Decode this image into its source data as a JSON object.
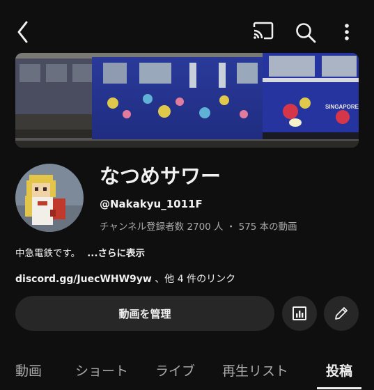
{
  "channel": {
    "name": "なつめサワー",
    "handle": "@Nakakyu_1011F",
    "stats": "チャンネル登録者数 2700 人 ・ 575 本の動画",
    "description": "中急電鉄です。",
    "more_label": "...さらに表示",
    "link_text": "discord.gg/JuecWHW9yw",
    "link_suffix": "、他 4 件のリンク",
    "banner_text": "SINGAPORE"
  },
  "actions": {
    "manage_label": "動画を管理"
  },
  "tabs": [
    {
      "label": "動画"
    },
    {
      "label": "ショート"
    },
    {
      "label": "ライブ"
    },
    {
      "label": "再生リスト"
    },
    {
      "label": "投稿"
    }
  ],
  "icons": {
    "back": "back-arrow-icon",
    "cast": "cast-icon",
    "search": "search-icon",
    "more": "more-vert-icon",
    "analytics": "analytics-icon",
    "edit": "pencil-icon"
  },
  "colors": {
    "background": "#0f0f0f",
    "button_bg": "#272727",
    "text": "#f1f1f1",
    "secondary_text": "#aaaaaa"
  }
}
